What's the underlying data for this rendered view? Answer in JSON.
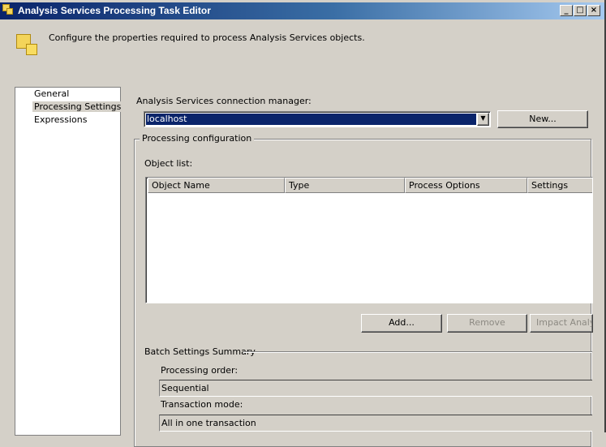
{
  "window": {
    "title": "Analysis Services Processing Task Editor",
    "description": "Configure the properties required to process Analysis Services objects."
  },
  "nav": {
    "items": [
      {
        "label": "General"
      },
      {
        "label": "Processing Settings"
      },
      {
        "label": "Expressions"
      }
    ],
    "selected": "Processing Settings"
  },
  "connection": {
    "label": "Analysis Services connection manager:",
    "value": "localhost",
    "new_label": "New..."
  },
  "processing": {
    "group_label": "Processing configuration",
    "object_list_label": "Object list:",
    "columns": [
      "Object Name",
      "Type",
      "Process Options",
      "Settings"
    ],
    "rows": [],
    "add_label": "Add...",
    "remove_label": "Remove",
    "impact_label": "Impact Analys"
  },
  "batch": {
    "label": "Batch Settings Summary",
    "order_label": "Processing order:",
    "order_value": "Sequential",
    "transaction_label": "Transaction mode:",
    "transaction_value": "All in one transaction"
  },
  "colors": {
    "selection": "#0a246a",
    "face": "#d4d0c8"
  }
}
